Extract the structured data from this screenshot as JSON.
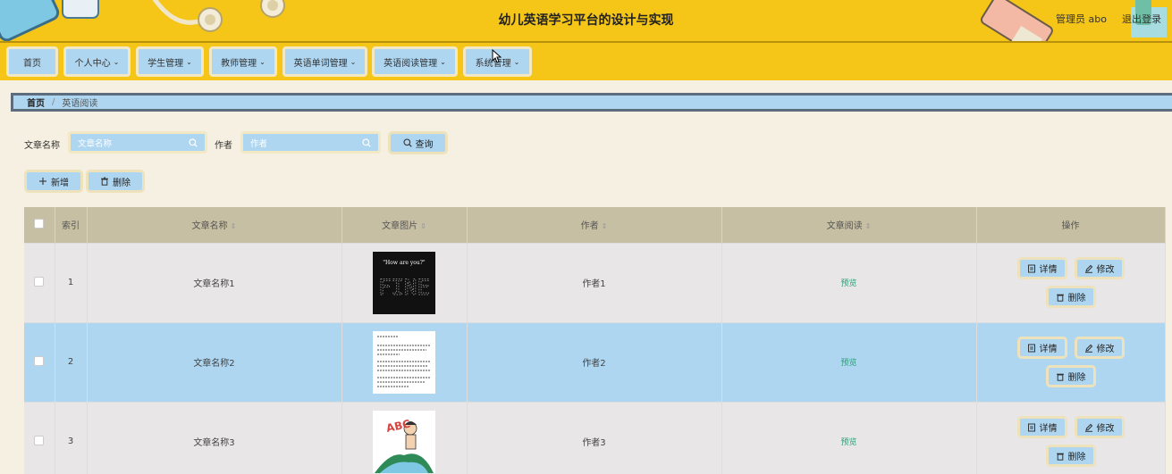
{
  "header": {
    "title": "幼儿英语学习平台的设计与实现",
    "user": "管理员 abo",
    "logout": "退出登录"
  },
  "nav": [
    {
      "label": "首页",
      "dropdown": false
    },
    {
      "label": "个人中心",
      "dropdown": true
    },
    {
      "label": "学生管理",
      "dropdown": true
    },
    {
      "label": "教师管理",
      "dropdown": true
    },
    {
      "label": "英语单词管理",
      "dropdown": true
    },
    {
      "label": "英语阅读管理",
      "dropdown": true
    },
    {
      "label": "系统管理",
      "dropdown": true
    }
  ],
  "breadcrumb": {
    "home": "首页",
    "separator": "/",
    "current": "英语阅读"
  },
  "search": {
    "title_label": "文章名称",
    "title_placeholder": "文章名称",
    "author_label": "作者",
    "author_placeholder": "作者",
    "query_button": "查询"
  },
  "actions": {
    "add": "新增",
    "delete": "删除"
  },
  "table": {
    "columns": [
      "索引",
      "文章名称",
      "文章图片",
      "作者",
      "文章阅读",
      "操作"
    ],
    "rows": [
      {
        "index": "1",
        "title": "文章名称1",
        "image": "fine-card",
        "author": "作者1",
        "read": "预览"
      },
      {
        "index": "2",
        "title": "文章名称2",
        "image": "text-page",
        "author": "作者2",
        "read": "预览"
      },
      {
        "index": "3",
        "title": "文章名称3",
        "image": "cartoon-abc",
        "author": "作者3",
        "read": "预览"
      }
    ],
    "op_labels": {
      "detail": "详情",
      "edit": "修改",
      "delete": "删除"
    },
    "image_texts": {
      "fine_caption": "\"How are you?\"",
      "fine_word": "FINE",
      "abc": "ABC"
    }
  },
  "colors": {
    "header_bg": "#f5c518",
    "button_bg": "#aed6f1",
    "page_bg": "#f5f0e1",
    "table_head": "#c7bfa3",
    "preview_link": "#2e9e7a"
  }
}
